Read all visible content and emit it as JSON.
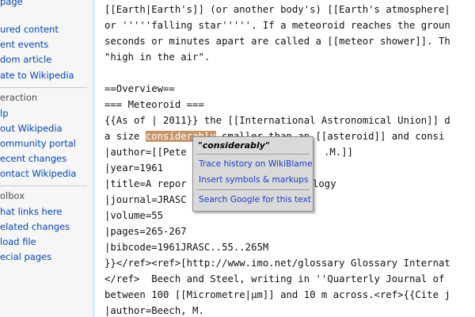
{
  "sidebar": {
    "nav_items": [
      "page",
      "ured content",
      "ent events",
      "dom article",
      "ate to Wikipedia"
    ],
    "interaction_heading": "eraction",
    "interaction_items": [
      "lp",
      "out Wikipedia",
      "ommunity portal",
      "ecent changes",
      "ontact Wikipedia"
    ],
    "toolbox_heading": "olbox",
    "toolbox_items": [
      "hat links here",
      "elated changes",
      "load file",
      "ecial pages"
    ]
  },
  "editor": {
    "lines": [
      "[[Earth|Earth's]] (or another body's) [[Earth's atmosphere|",
      "or '''''falling star'''''. If a meteoroid reaches the groun",
      "seconds or minutes apart are called a [[meteor shower]]. Th",
      "\"high in the air\".",
      "",
      "==Overview==",
      "=== Meteoroid ===",
      "{{As of | 2011}} the [[International Astronomical Union]] d",
      "",
      "|author=[[Pete",
      "|year=1961",
      "|title=A repor",
      "|journal=JRASC",
      "|volume=55",
      "|pages=265-267",
      "|bibcode=1961JRASC..55..265M",
      "}}</ref><ref>[http://www.imo.net/glossary Glossary Internat",
      "</ref>  Beech and Steel, writing in ''Quarterly Journal of",
      "between 100 [[Micrometre|µm]] and 10 m across.<ref>{{Cite j",
      "|author=Beech, M."
    ],
    "line9_before": "a size ",
    "line9_highlight": "considerably",
    "line9_after": " smaller than an [[asteroid]] and consi",
    "line10_tail": ".M.]]",
    "line12_tail": "logy"
  },
  "popup": {
    "title": "\"considerably\"",
    "items": [
      "Trace history on WikiBlame",
      "Insert symbols & markups",
      "Search Google for this text"
    ]
  }
}
